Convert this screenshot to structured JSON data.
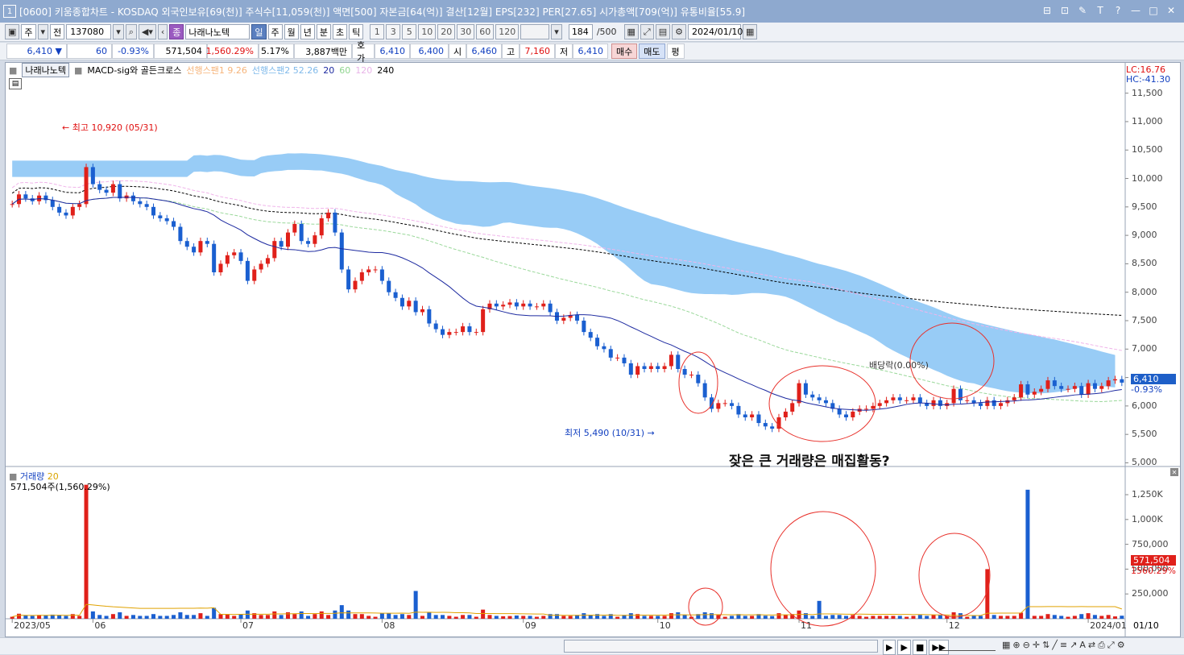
{
  "window": {
    "number": "1",
    "title": "[0600] 키움종합차트 - KOSDAQ 외국인보유[69(천)] 주식수[11,059(천)] 액면[500] 자본금[64(억)] 결산[12월] EPS[232] PER[27.65] 시가총액[709(억)] 유통비율[55.9]",
    "controls": [
      "⊟",
      "⊡",
      "✎",
      "T",
      "?",
      "—",
      "□",
      "✕"
    ]
  },
  "toolbar": {
    "period_main": "주",
    "period_dd": "▾",
    "mode": "전",
    "code": "137080",
    "name": "나래나노텍",
    "tabs": [
      "일",
      "주",
      "월",
      "년",
      "분",
      "초",
      "틱"
    ],
    "nums": [
      "1",
      "3",
      "5",
      "10",
      "20",
      "30",
      "60",
      "120"
    ],
    "count": "184",
    "count_max": "/500",
    "date": "2024/01/10"
  },
  "quote": {
    "price": "6,410",
    "arrow": "▼",
    "change": "60",
    "change_pct": "-0.93%",
    "volume": "571,504",
    "volume_pct": "1,560.29%",
    "turnover": "5.17%",
    "amount": "3,887백만",
    "ask_label": "호가",
    "ask": "6,410",
    "bid": "6,400",
    "open_label": "시",
    "open": "6,460",
    "high_label": "고",
    "high": "7,160",
    "low_label": "저",
    "low": "6,410",
    "buy": "매수",
    "sell": "매도",
    "eval": "평"
  },
  "price_panel": {
    "stock_tag": "나래나노텍",
    "indicator": "MACD-sig와 골든크로스",
    "span1": "선행스팬1 9.26",
    "span2": "선행스팬2 52.26",
    "ma20": "20",
    "ma60": "60",
    "ma120": "120",
    "ma240": "240",
    "lc": "LC:16.76",
    "hc": "HC:-41.30",
    "current_price": "6,410",
    "current_pct": "-0.93%",
    "high_marker": "최고 10,920 (05/31)",
    "low_marker": "최저 5,490 (10/31)",
    "dividend": "배당락(0.00%)",
    "y_ticks": [
      "11,500",
      "11,000",
      "10,500",
      "10,000",
      "9,500",
      "9,000",
      "8,500",
      "8,000",
      "7,500",
      "7,000",
      "6,500",
      "6,000",
      "5,500",
      "5,000"
    ],
    "y_min": 4950,
    "y_max": 11750
  },
  "volume_panel": {
    "title": "거래량",
    "ma": "20",
    "current": "571,504주(1,560.29%)",
    "current_vol": "571,504",
    "current_pct": "1560.29%",
    "y_ticks": [
      "1,250K",
      "1,000K",
      "750,000",
      "500,000",
      "250,000"
    ],
    "y_max": 1380000
  },
  "x_labels": [
    "2023/05",
    "06",
    "07",
    "08",
    "09",
    "10",
    "11",
    "12",
    "2024/01"
  ],
  "x_right": "01/10",
  "annotation": "잦은 큰 거래량은 매집활동?",
  "colors": {
    "up": "#e0201a",
    "down": "#1a5fd0",
    "cloud": "#8dc6f5",
    "cloud_orange": "#fbbf8c",
    "circle": "#e8302a"
  },
  "chart_data": {
    "type": "candlestick",
    "x": [
      "05/15",
      "05/16",
      "05/17",
      "05/18",
      "05/19",
      "05/22",
      "05/23",
      "05/24",
      "05/25",
      "05/26",
      "05/30",
      "05/31",
      "06/01",
      "06/02",
      "06/05",
      "06/07",
      "06/08",
      "06/09",
      "06/12",
      "06/13",
      "06/14",
      "06/15",
      "06/16",
      "06/19",
      "06/20",
      "06/21",
      "06/22",
      "06/23",
      "06/26",
      "06/27",
      "06/28",
      "06/29",
      "06/30",
      "07/03",
      "07/04",
      "07/05",
      "07/06",
      "07/07",
      "07/10",
      "07/11",
      "07/12",
      "07/13",
      "07/14",
      "07/17",
      "07/18",
      "07/19",
      "07/20",
      "07/21",
      "07/24",
      "07/25",
      "07/26",
      "07/27",
      "07/28",
      "07/31",
      "08/01",
      "08/02",
      "08/03",
      "08/04",
      "08/07",
      "08/08",
      "08/09",
      "08/10",
      "08/11",
      "08/14",
      "08/16",
      "08/17",
      "08/18",
      "08/21",
      "08/22",
      "08/23",
      "08/24",
      "08/25",
      "08/28",
      "08/29",
      "08/30",
      "08/31",
      "09/01",
      "09/04",
      "09/05",
      "09/06",
      "09/07",
      "09/08",
      "09/11",
      "09/12",
      "09/13",
      "09/14",
      "09/15",
      "09/18",
      "09/19",
      "09/20",
      "09/21",
      "09/22",
      "09/25",
      "09/26",
      "09/27",
      "10/04",
      "10/05",
      "10/06",
      "10/10",
      "10/11",
      "10/12",
      "10/13",
      "10/16",
      "10/17",
      "10/18",
      "10/19",
      "10/20",
      "10/23",
      "10/24",
      "10/25",
      "10/26",
      "10/27",
      "10/30",
      "10/31",
      "11/01",
      "11/02",
      "11/03",
      "11/06",
      "11/07",
      "11/08",
      "11/09",
      "11/10",
      "11/13",
      "11/14",
      "11/15",
      "11/16",
      "11/17",
      "11/20",
      "11/21",
      "11/22",
      "11/23",
      "11/24",
      "11/27",
      "11/28",
      "11/29",
      "11/30",
      "12/01",
      "12/04",
      "12/05",
      "12/06",
      "12/07",
      "12/08",
      "12/11",
      "12/12",
      "12/13",
      "12/14",
      "12/15",
      "12/18",
      "12/19",
      "12/20",
      "12/21",
      "12/22",
      "12/26",
      "12/27",
      "12/28",
      "01/02",
      "01/03",
      "01/04",
      "01/05",
      "01/08",
      "01/09",
      "01/10"
    ],
    "close": [
      9550,
      9720,
      9650,
      9600,
      9700,
      9620,
      9500,
      9400,
      9350,
      9500,
      9550,
      10200,
      9900,
      9800,
      9750,
      9900,
      9650,
      9700,
      9600,
      9550,
      9500,
      9350,
      9300,
      9250,
      9150,
      8900,
      8800,
      8700,
      8900,
      8850,
      8350,
      8500,
      8650,
      8700,
      8550,
      8200,
      8400,
      8500,
      8600,
      8900,
      8800,
      9050,
      9200,
      8900,
      8850,
      9000,
      9300,
      9400,
      9050,
      8400,
      8050,
      8200,
      8350,
      8400,
      8400,
      8200,
      8000,
      7900,
      7750,
      7850,
      7650,
      7700,
      7450,
      7350,
      7250,
      7300,
      7300,
      7400,
      7300,
      7300,
      7700,
      7800,
      7750,
      7780,
      7820,
      7750,
      7800,
      7750,
      7750,
      7800,
      7650,
      7500,
      7550,
      7600,
      7500,
      7300,
      7200,
      7050,
      7000,
      6850,
      6850,
      6750,
      6550,
      6700,
      6650,
      6700,
      6650,
      6700,
      6900,
      6650,
      6550,
      6550,
      6400,
      6150,
      5950,
      6050,
      6050,
      6000,
      5850,
      5800,
      5850,
      5700,
      5640,
      5600,
      5800,
      5900,
      6050,
      6400,
      6200,
      6150,
      6100,
      6050,
      5950,
      5850,
      5800,
      5900,
      5950,
      5950,
      6000,
      6050,
      6100,
      6150,
      6100,
      6100,
      6150,
      6050,
      6000,
      6100,
      6000,
      6050,
      6300,
      6100,
      6100,
      6050,
      6000,
      6100,
      6000,
      6050,
      6100,
      6150,
      6380,
      6200,
      6250,
      6300,
      6450,
      6350,
      6300,
      6300,
      6350,
      6200,
      6400,
      6300,
      6350,
      6450,
      6470,
      6410
    ]
  }
}
